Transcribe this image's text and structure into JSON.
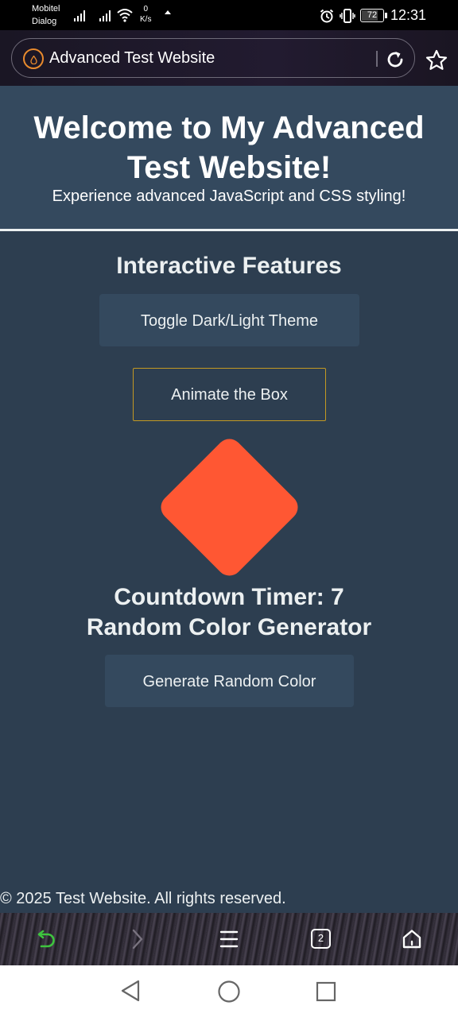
{
  "status_bar": {
    "carrier_1": "Mobitel",
    "carrier_2": "Dialog",
    "net_speed_value": "0",
    "net_speed_unit": "K/s",
    "battery": "72",
    "time": "12:31"
  },
  "browser": {
    "page_title": "Advanced Test Website",
    "tab_count": "2",
    "icon_color": "#e88a2d",
    "back_icon_color": "#3ec43e"
  },
  "header": {
    "title": "Welcome to My Advanced Test Website!",
    "subtitle": "Experience advanced JavaScript and CSS styling!"
  },
  "features": {
    "heading": "Interactive Features",
    "toggle_theme_label": "Toggle Dark/Light Theme",
    "animate_box_label": "Animate the Box",
    "box_color": "#ff5733",
    "countdown_text": "Countdown Timer: 7",
    "random_color_heading": "Random Color Generator",
    "random_color_button_label": "Generate Random Color"
  },
  "footer": {
    "text": "© 2025 Test Website. All rights reserved."
  },
  "colors": {
    "page_background": "#2d3e50",
    "header_background": "#34495e",
    "button_background": "#34495e",
    "animate_border": "#c39922",
    "text": "#ecf0f1"
  }
}
